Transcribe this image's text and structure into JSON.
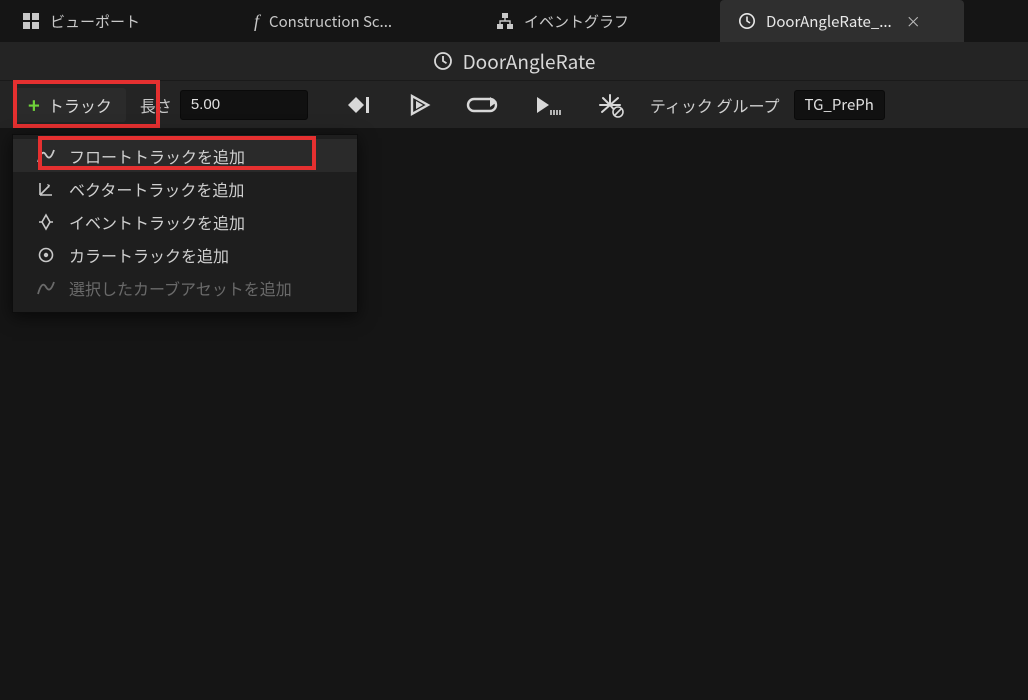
{
  "tabs": {
    "viewport": {
      "label": "ビューポート"
    },
    "construct": {
      "label": "Construction Sc..."
    },
    "eventgraph": {
      "label": "イベントグラフ"
    },
    "timeline": {
      "label": "DoorAngleRate_...",
      "close": "×"
    }
  },
  "title": "DoorAngleRate",
  "toolbar": {
    "track_label": "トラック",
    "length_label": "長さ",
    "length_value": "5.00",
    "tickgroup_label": "ティック グループ",
    "tickgroup_value": "TG_PrePh"
  },
  "menu": {
    "add_float": "フロートトラックを追加",
    "add_vector": "ベクタートラックを追加",
    "add_event": "イベントトラックを追加",
    "add_color": "カラートラックを追加",
    "add_curve": "選択したカーブアセットを追加"
  }
}
